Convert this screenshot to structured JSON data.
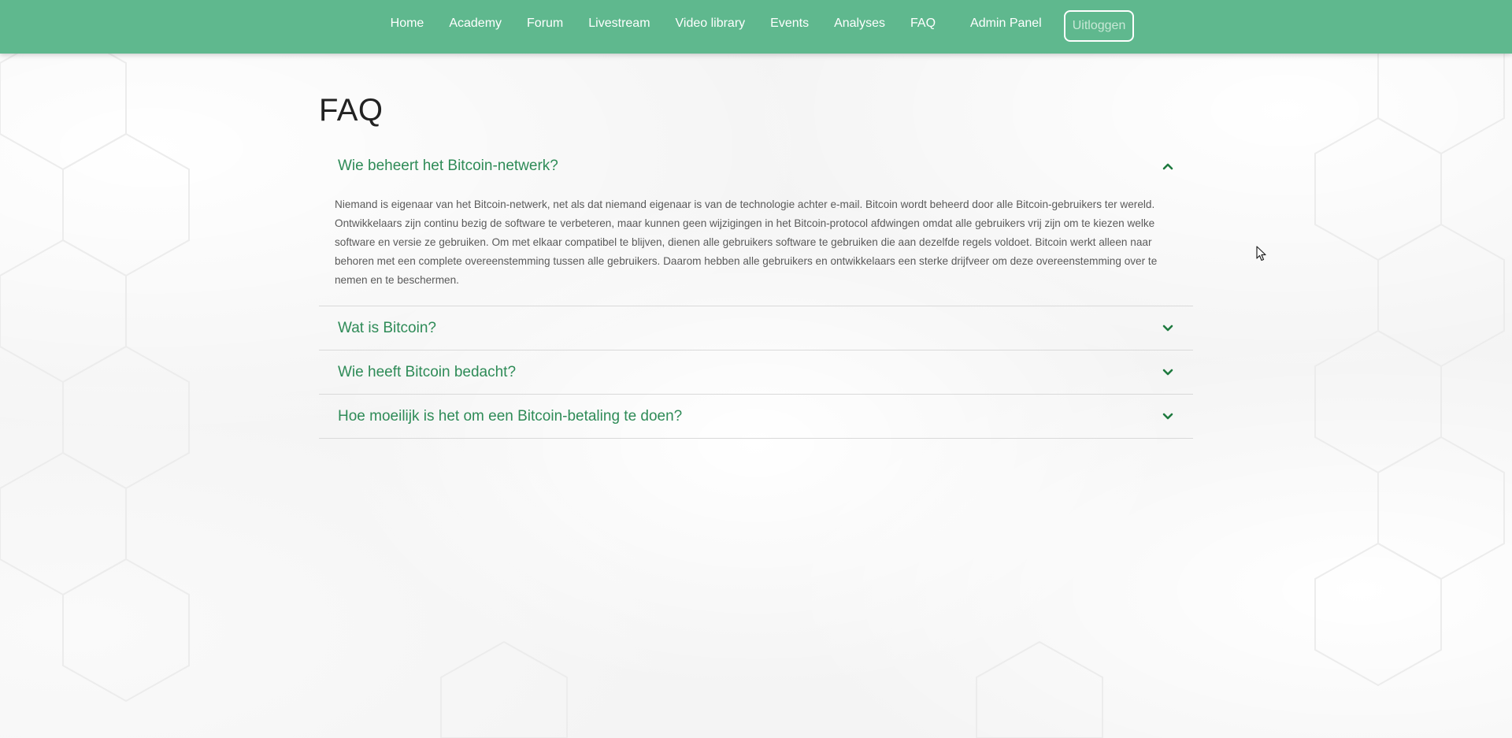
{
  "nav": {
    "items": [
      {
        "label": "Home"
      },
      {
        "label": "Academy"
      },
      {
        "label": "Forum"
      },
      {
        "label": "Livestream"
      },
      {
        "label": "Video library"
      },
      {
        "label": "Events"
      },
      {
        "label": "Analyses"
      },
      {
        "label": "FAQ"
      },
      {
        "label": "Admin Panel"
      }
    ],
    "logout_label": "Uitloggen"
  },
  "page": {
    "title": "FAQ"
  },
  "faq": {
    "items": [
      {
        "question": "Wie beheert het Bitcoin-netwerk?",
        "expanded": true,
        "answer": "Niemand is eigenaar van het Bitcoin-netwerk, net als dat niemand eigenaar is van de technologie achter e-mail. Bitcoin wordt beheerd door alle Bitcoin-gebruikers ter wereld. Ontwikkelaars zijn continu bezig de software te verbeteren, maar kunnen geen wijzigingen in het Bitcoin-protocol afdwingen omdat alle gebruikers vrij zijn om te kiezen welke software en versie ze gebruiken. Om met elkaar compatibel te blijven, dienen alle gebruikers software te gebruiken die aan dezelfde regels voldoet. Bitcoin werkt alleen naar behoren met een complete overeenstemming tussen alle gebruikers. Daarom hebben alle gebruikers en ontwikkelaars een sterke drijfveer om deze overeenstemming over te nemen en te beschermen."
      },
      {
        "question": "Wat is Bitcoin?",
        "expanded": false
      },
      {
        "question": "Wie heeft Bitcoin bedacht?",
        "expanded": false
      },
      {
        "question": "Hoe moeilijk is het om een Bitcoin-betaling te doen?",
        "expanded": false
      }
    ]
  },
  "colors": {
    "navbar": "#5fb88e",
    "accent": "#2e8b57",
    "chevron": "#1f7a3f"
  },
  "icons": {
    "expanded": "chevron-up-icon",
    "collapsed": "chevron-down-icon"
  }
}
